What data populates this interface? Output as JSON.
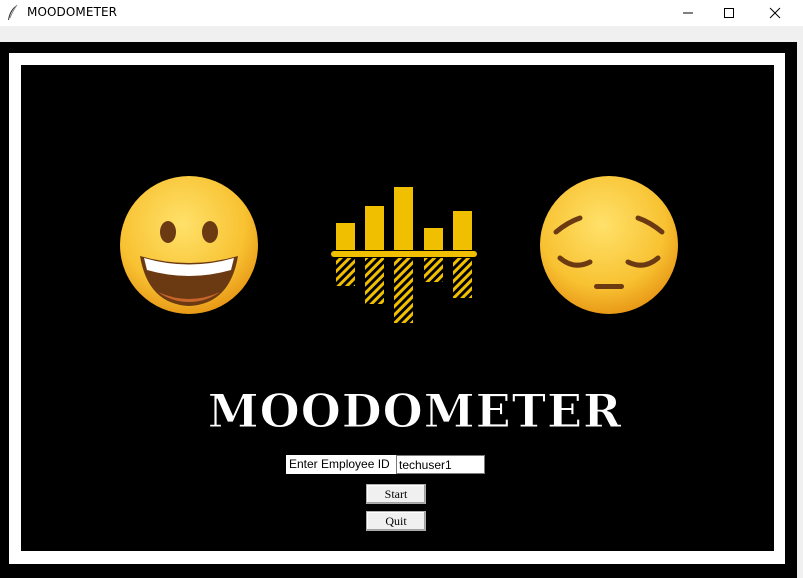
{
  "window": {
    "title": "MOODOMETER",
    "controls": {
      "minimize": "minimize-icon",
      "maximize": "maximize-icon",
      "close": "close-icon"
    }
  },
  "banner": {
    "logo_text": "MOODOMETER",
    "left_icon": "grinning-face-emoji",
    "center_icon": "mood-bars-icon",
    "right_icon": "pensive-face-emoji"
  },
  "form": {
    "employee_label": "Enter Employee ID",
    "employee_value": "techuser1",
    "start_label": "Start",
    "quit_label": "Quit"
  },
  "colors": {
    "background": "#000000",
    "border": "#ffffff",
    "bars": "#f0c000",
    "emoji": "#fbc83a"
  }
}
